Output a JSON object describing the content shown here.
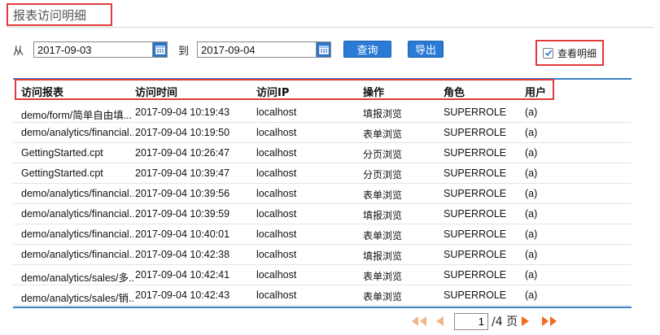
{
  "page": {
    "title": "报表访问明细"
  },
  "filters": {
    "from_label": "从",
    "from_date": "2017-09-03",
    "to_label": "到",
    "to_date": "2017-09-04",
    "query_label": "查询",
    "export_label": "导出",
    "detail_label": "查看明细",
    "detail_checked": true
  },
  "table": {
    "columns": [
      "访问报表",
      "访问时间",
      "访问IP",
      "操作",
      "角色",
      "用户"
    ],
    "rows": [
      [
        "demo/form/简单自由填...",
        "2017-09-04 10:19:43",
        "localhost",
        "填报浏览",
        "SUPERROLE",
        "(a)"
      ],
      [
        "demo/analytics/financial...",
        "2017-09-04 10:19:50",
        "localhost",
        "表单浏览",
        "SUPERROLE",
        "(a)"
      ],
      [
        "GettingStarted.cpt",
        "2017-09-04 10:26:47",
        "localhost",
        "分页浏览",
        "SUPERROLE",
        "(a)"
      ],
      [
        "GettingStarted.cpt",
        "2017-09-04 10:39:47",
        "localhost",
        "分页浏览",
        "SUPERROLE",
        "(a)"
      ],
      [
        "demo/analytics/financial...",
        "2017-09-04 10:39:56",
        "localhost",
        "表单浏览",
        "SUPERROLE",
        "(a)"
      ],
      [
        "demo/analytics/financial...",
        "2017-09-04 10:39:59",
        "localhost",
        "填报浏览",
        "SUPERROLE",
        "(a)"
      ],
      [
        "demo/analytics/financial...",
        "2017-09-04 10:40:01",
        "localhost",
        "表单浏览",
        "SUPERROLE",
        "(a)"
      ],
      [
        "demo/analytics/financial...",
        "2017-09-04 10:42:38",
        "localhost",
        "填报浏览",
        "SUPERROLE",
        "(a)"
      ],
      [
        "demo/analytics/sales/多...",
        "2017-09-04 10:42:41",
        "localhost",
        "表单浏览",
        "SUPERROLE",
        "(a)"
      ],
      [
        "demo/analytics/sales/销...",
        "2017-09-04 10:42:43",
        "localhost",
        "表单浏览",
        "SUPERROLE",
        "(a)"
      ]
    ]
  },
  "pagination": {
    "current_page": "1",
    "total_label": "/4 页"
  },
  "icons": {
    "first": "double-left-arrow-icon",
    "prev": "left-arrow-icon",
    "next": "right-arrow-icon",
    "last": "double-right-arrow-icon",
    "calendar": "calendar-icon"
  },
  "colors": {
    "accent": "#2a7ad6",
    "highlight": "#e03a3a",
    "pager_active": "#f26b1d",
    "pager_disabled": "#f3b488",
    "rule": "#3a7fc6"
  }
}
